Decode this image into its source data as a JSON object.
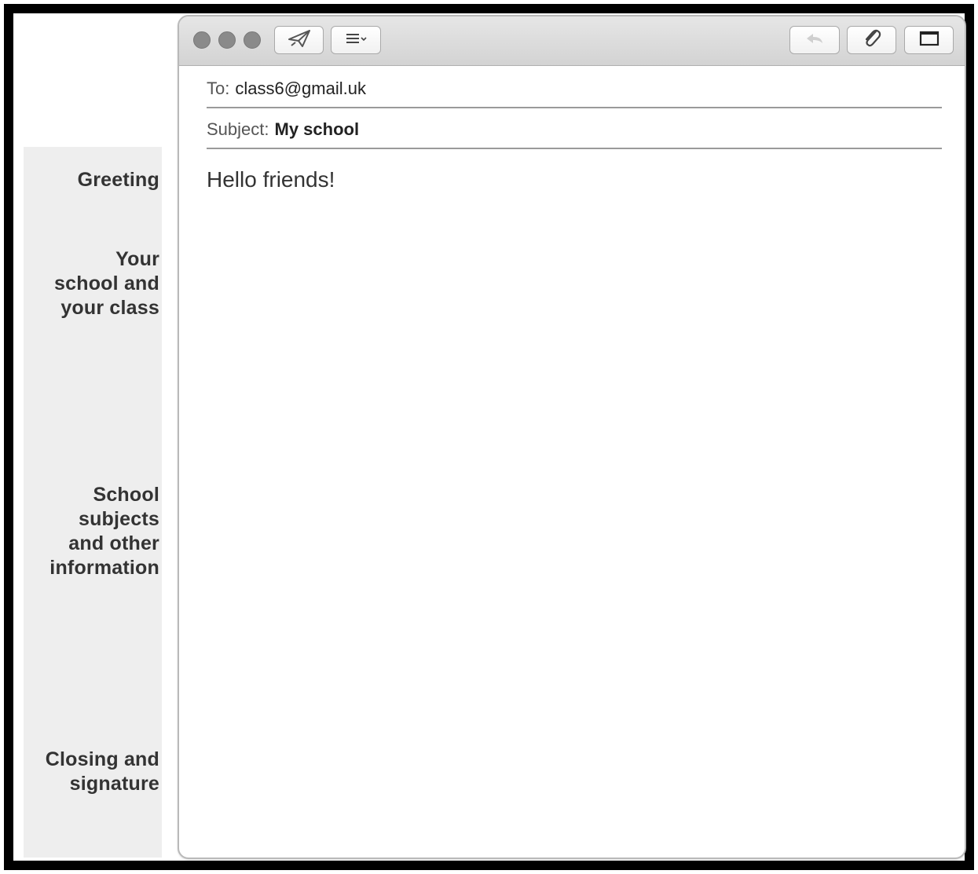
{
  "sidebar": {
    "labels": [
      "Greeting",
      "Your\nschool and\nyour class",
      "School\nsubjects\nand other\ninformation",
      "Closing and\nsignature"
    ]
  },
  "compose": {
    "to_label": "To:",
    "to_value": "class6@gmail.uk",
    "subject_label": "Subject:",
    "subject_value": "My school",
    "body": "Hello friends!"
  },
  "toolbar": {
    "icons": [
      "send-icon",
      "format-list-icon",
      "reply-icon",
      "attachment-icon",
      "window-icon"
    ]
  }
}
